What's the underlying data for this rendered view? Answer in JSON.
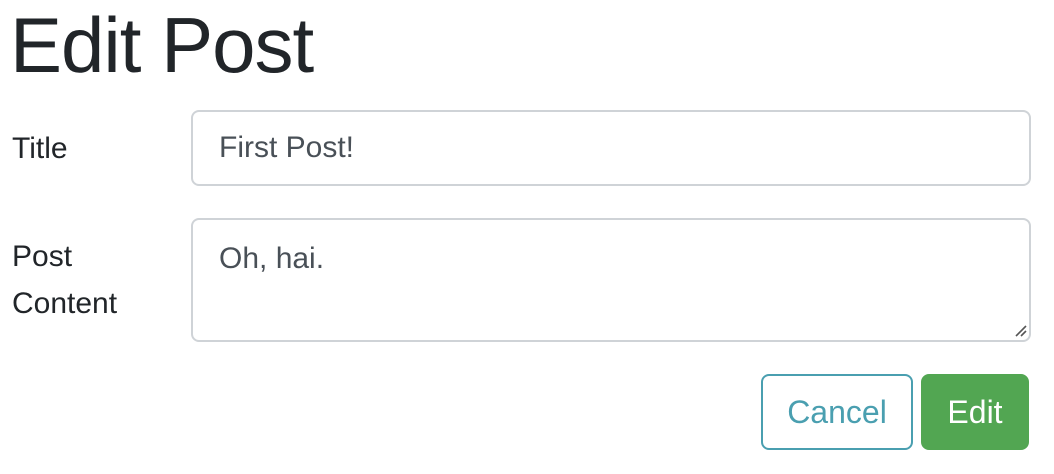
{
  "page": {
    "title": "Edit Post"
  },
  "form": {
    "title_label": "Title",
    "title_value": "First Post!",
    "content_label": "Post Content",
    "content_value": "Oh, hai.",
    "cancel_label": "Cancel",
    "submit_label": "Edit"
  },
  "colors": {
    "text": "#212529",
    "input_text": "#495057",
    "input_border": "#cfd3d7",
    "cancel_outline": "#4a9fb0",
    "submit_bg": "#52a652",
    "submit_text": "#ffffff"
  },
  "icons": {
    "resize": "resize-handle-icon"
  }
}
